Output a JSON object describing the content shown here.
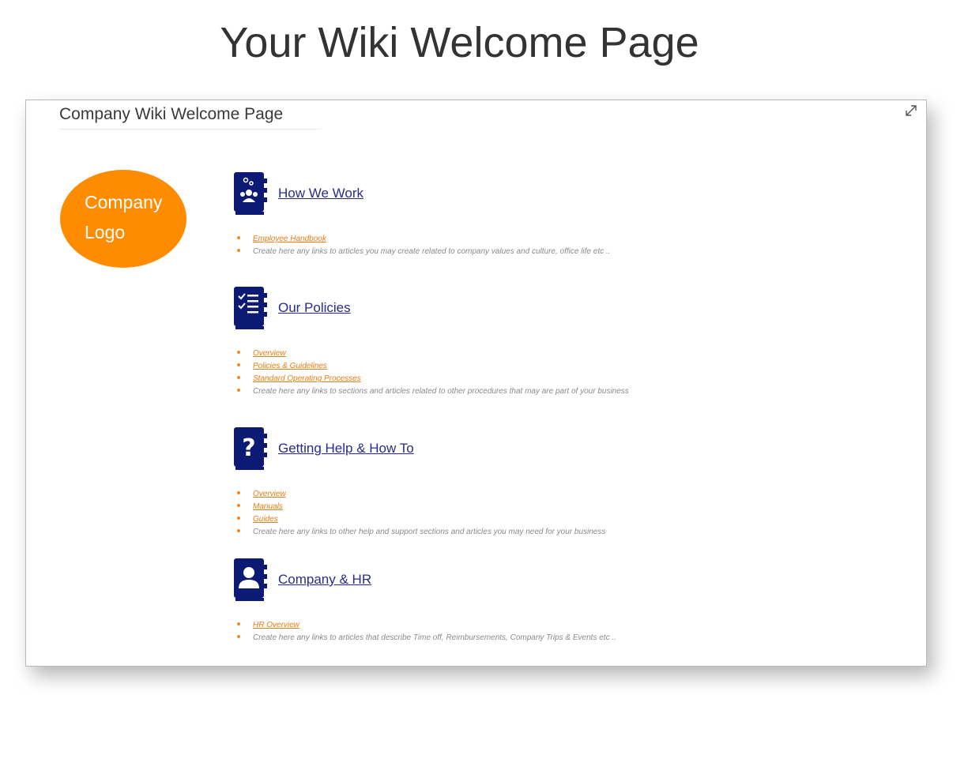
{
  "page_heading": "Your Wiki Welcome Page",
  "doc_title": "Company Wiki Welcome Page",
  "logo": {
    "line1": "Company",
    "line2": "Logo",
    "color": "#ff8c00"
  },
  "colors": {
    "icon_navy": "#0c1a73",
    "section_link": "#2a2a8c",
    "bullet_link": "#f07a10",
    "bullet_dot": "#f08a24"
  },
  "sections": [
    {
      "title": "How We Work",
      "icon": "team-book-icon",
      "links": [
        "Employee Handbook"
      ],
      "note": "Create here any links to articles you may create related to company values and culture, office life etc .."
    },
    {
      "title": "Our Policies",
      "icon": "checklist-book-icon",
      "links": [
        "Overview",
        "Policies & Guidelines",
        "Standard Operating Processes"
      ],
      "note": "Create here any links to sections and articles related to other procedures that may are part of your business"
    },
    {
      "title": "Getting Help & How To",
      "icon": "question-book-icon",
      "links": [
        "Overview",
        "Manuals",
        "Guides"
      ],
      "note": "Create here any links to other help and support sections and articles you may need for your business"
    },
    {
      "title": "Company & HR",
      "icon": "contact-book-icon",
      "links": [
        "HR Overview"
      ],
      "note": "Create here any links to articles that describe Time off, Reimbursements, Company Trips & Events etc .."
    }
  ]
}
